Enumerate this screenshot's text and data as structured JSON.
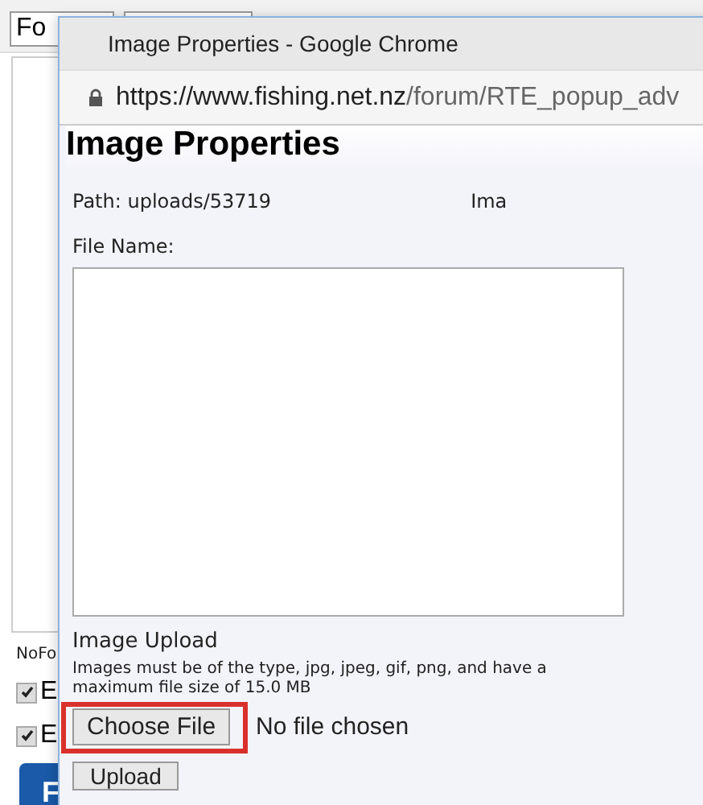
{
  "editor": {
    "font_select": "Fo",
    "status_text": "NoFo",
    "options": [
      {
        "label": "E",
        "checked": true
      },
      {
        "label": "E",
        "checked": true
      }
    ],
    "button": "F"
  },
  "popup": {
    "window_title": "Image Properties - Google Chrome",
    "url_host": "https://www.fishing.net.nz",
    "url_path": "/forum/RTE_popup_adv",
    "heading": "Image Properties",
    "path": "Path: uploads/53719",
    "right_label": "Ima",
    "file_name_label": "File Name:",
    "upload_heading": "Image Upload",
    "upload_note": "Images must be of the type, jpg, jpeg, gif, png, and have a maximum file size of 15.0 MB",
    "choose_button": "Choose File",
    "file_status": "No file chosen",
    "upload_button": "Upload"
  }
}
